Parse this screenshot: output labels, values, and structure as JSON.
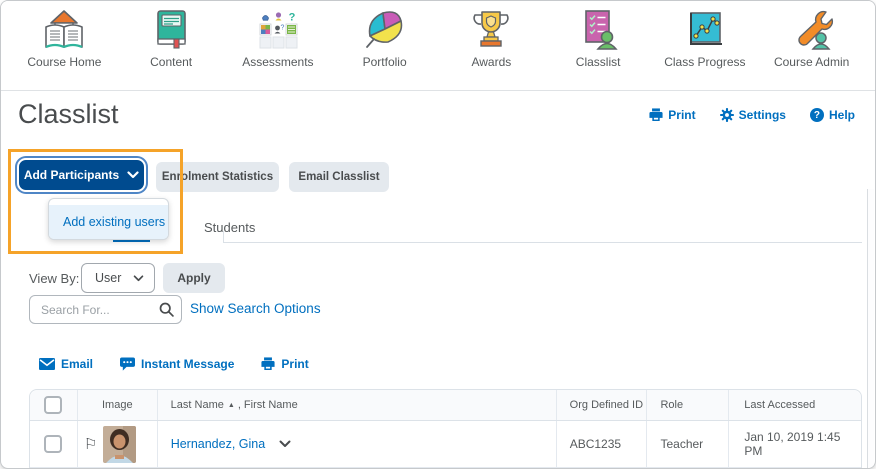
{
  "nav": {
    "items": [
      {
        "label": "Course Home",
        "icon": "course-home-icon"
      },
      {
        "label": "Content",
        "icon": "content-icon"
      },
      {
        "label": "Assessments",
        "icon": "assessments-icon"
      },
      {
        "label": "Portfolio",
        "icon": "portfolio-icon"
      },
      {
        "label": "Awards",
        "icon": "awards-icon"
      },
      {
        "label": "Classlist",
        "icon": "classlist-icon"
      },
      {
        "label": "Class Progress",
        "icon": "class-progress-icon"
      },
      {
        "label": "Course Admin",
        "icon": "course-admin-icon"
      }
    ]
  },
  "header": {
    "title": "Classlist",
    "print_label": "Print",
    "settings_label": "Settings",
    "help_label": "Help"
  },
  "toolbar": {
    "add_participants_label": "Add Participants",
    "enrolment_statistics_label": "Enrolment Statistics",
    "email_classlist_label": "Email Classlist"
  },
  "add_menu": {
    "items": [
      {
        "label": "Add existing users"
      }
    ]
  },
  "tabs": {
    "students_label": "Students"
  },
  "filters": {
    "view_by_label": "View By:",
    "view_by_value": "User",
    "apply_label": "Apply",
    "search_placeholder": "Search For...",
    "show_search_options_label": "Show Search Options"
  },
  "bulk_actions": {
    "email_label": "Email",
    "instant_message_label": "Instant Message",
    "print_label": "Print"
  },
  "table": {
    "columns": {
      "image": "Image",
      "last_name": "Last Name",
      "first_name_suffix": ", First Name",
      "org_defined_id": "Org Defined ID",
      "role": "Role",
      "last_accessed": "Last Accessed"
    },
    "rows": [
      {
        "name": "Hernandez, Gina",
        "org_defined_id": "ABC1235",
        "role": "Teacher",
        "last_accessed": "Jan 10, 2019 1:45 PM"
      }
    ]
  },
  "glyphs": {
    "help": "?",
    "sort_ascending": "▲",
    "flag": "⚐"
  },
  "colors": {
    "accent_blue": "#006fbf",
    "primary_navy": "#004b8f",
    "highlight_orange": "#f5a329",
    "button_gray": "#e4e9ee",
    "text_gray": "#565a5c"
  }
}
